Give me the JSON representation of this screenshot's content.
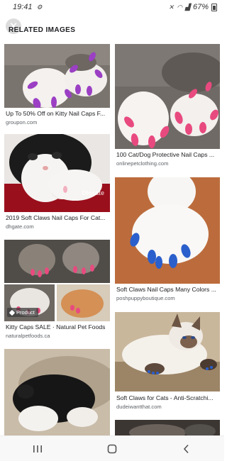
{
  "status_bar": {
    "time": "19:41",
    "battery": "67%"
  },
  "header": {
    "section_title": "RELATED IMAGES",
    "close_icon": "close-icon"
  },
  "results": [
    {
      "title": "Up To 50% Off on Kitty Nail Caps F...",
      "source": "groupon.com"
    },
    {
      "title": "100 Cat/Dog Protective Nail Caps ...",
      "source": "onlinepetclothing.com"
    },
    {
      "title": "2019 Soft Claws Nail Caps For Cat...",
      "source": "dhgate.com",
      "image_watermark": "DHgate"
    },
    {
      "title": "Soft Claws Nail Caps Many Colors ...",
      "source": "poshpuppyboutique.com"
    },
    {
      "title": "Kitty Caps SALE · Natural Pet Foods",
      "source": "naturalpetfoods.ca",
      "badge": "Product"
    },
    {
      "title": "Soft Claws for Cats - Anti-Scratchi...",
      "source": "dudeiwantthat.com"
    },
    {
      "title": ""
    },
    {
      "title": ""
    }
  ],
  "colors": {
    "cap_purple": "#9b3fc4",
    "cap_pink": "#e84a7f",
    "cap_blue": "#2a5fcc",
    "wood": "#c1703f"
  },
  "nav_bar": {
    "recents_icon": "recents-icon",
    "home_icon": "home-icon",
    "back_icon": "back-icon"
  }
}
